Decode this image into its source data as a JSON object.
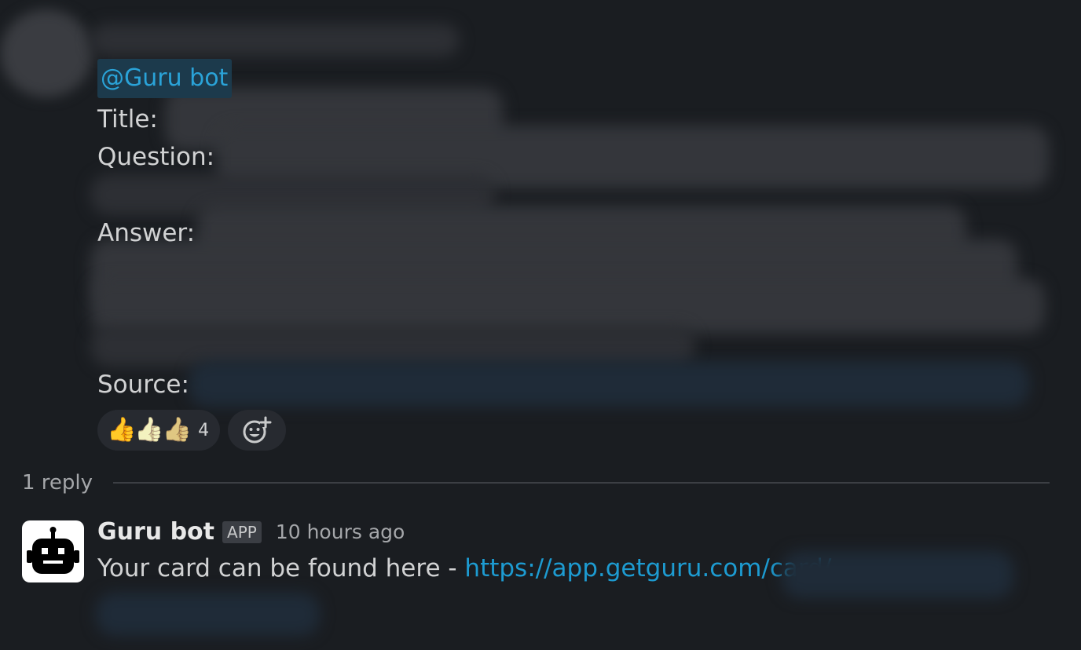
{
  "message": {
    "mention": "@Guru bot",
    "fields": {
      "title_label": "Title:",
      "question_label": "Question:",
      "answer_label": "Answer:",
      "source_label": "Source:"
    },
    "reactions": [
      {
        "emojis": [
          "thumbs-up",
          "thumbs-up-light-skin",
          "thumbs-up-medium-skin"
        ],
        "count": "4"
      },
      {
        "icon": "add-reaction-icon"
      }
    ]
  },
  "thread": {
    "reply_count_label": "1 reply"
  },
  "reply": {
    "author": "Guru bot",
    "badge": "APP",
    "timestamp": "10 hours ago",
    "text": "Your card can be found here - ",
    "link_text": "https://app.getguru.com/card/"
  },
  "colors": {
    "background": "#1a1d21",
    "mention_bg": "#1c3a4c",
    "mention_text": "#2aa3d8",
    "link": "#1d9bd1"
  }
}
